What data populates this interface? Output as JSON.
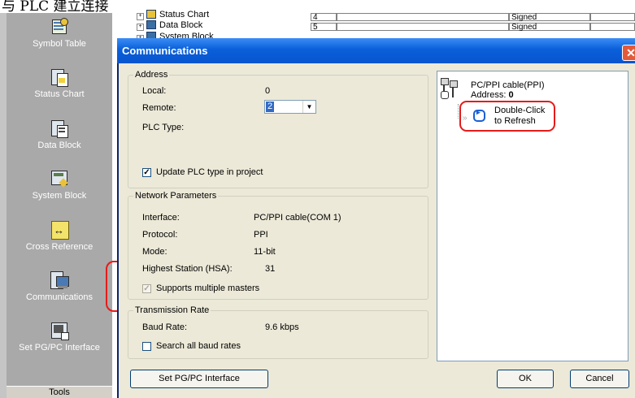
{
  "page_title": "与 PLC 建立连接",
  "nav": {
    "items": [
      {
        "label": "Symbol Table",
        "icon": "symbol-table-icon"
      },
      {
        "label": "Status Chart",
        "icon": "status-chart-icon"
      },
      {
        "label": "Data Block",
        "icon": "data-block-icon"
      },
      {
        "label": "System Block",
        "icon": "system-block-icon"
      },
      {
        "label": "Cross Reference",
        "icon": "cross-reference-icon"
      },
      {
        "label": "Communications",
        "icon": "communications-icon"
      },
      {
        "label": "Set PG/PC Interface",
        "icon": "set-pgpc-interface-icon"
      }
    ],
    "footer": "Tools"
  },
  "explorer": {
    "tree": [
      "Status Chart",
      "Data Block",
      "System Block"
    ],
    "grid_rows": [
      {
        "num": "4",
        "type": "Signed"
      },
      {
        "num": "5",
        "type": "Signed"
      }
    ]
  },
  "dialog": {
    "title": "Communications",
    "close": "✕",
    "address": {
      "title": "Address",
      "local_label": "Local:",
      "local_value": "0",
      "remote_label": "Remote:",
      "remote_value": "2",
      "plc_type_label": "PLC Type:",
      "update_label": "Update PLC type in project",
      "update_checked": true
    },
    "network": {
      "title": "Network Parameters",
      "interface_label": "Interface:",
      "interface_value": "PC/PPI cable(COM 1)",
      "protocol_label": "Protocol:",
      "protocol_value": "PPI",
      "mode_label": "Mode:",
      "mode_value": "11-bit",
      "hsa_label": "Highest Station (HSA):",
      "hsa_value": "31",
      "multi_label": "Supports multiple masters",
      "multi_checked": true
    },
    "transmission": {
      "title": "Transmission Rate",
      "baud_label": "Baud Rate:",
      "baud_value": "9.6 kbps",
      "search_label": "Search all baud rates",
      "search_checked": false
    },
    "tree": {
      "cable_label": "PC/PPI cable(PPI)",
      "address_prefix": "Address: ",
      "address_value": "0",
      "refresh_line1": "Double-Click",
      "refresh_line2": "to Refresh"
    },
    "buttons": {
      "set_pgpc": "Set PG/PC Interface",
      "ok": "OK",
      "cancel": "Cancel"
    }
  },
  "colors": {
    "title_bar": "#0a5fd9",
    "nav_bg": "#a9a9a9",
    "dialog_bg": "#ece9d8",
    "highlight": "#e51b1b"
  }
}
